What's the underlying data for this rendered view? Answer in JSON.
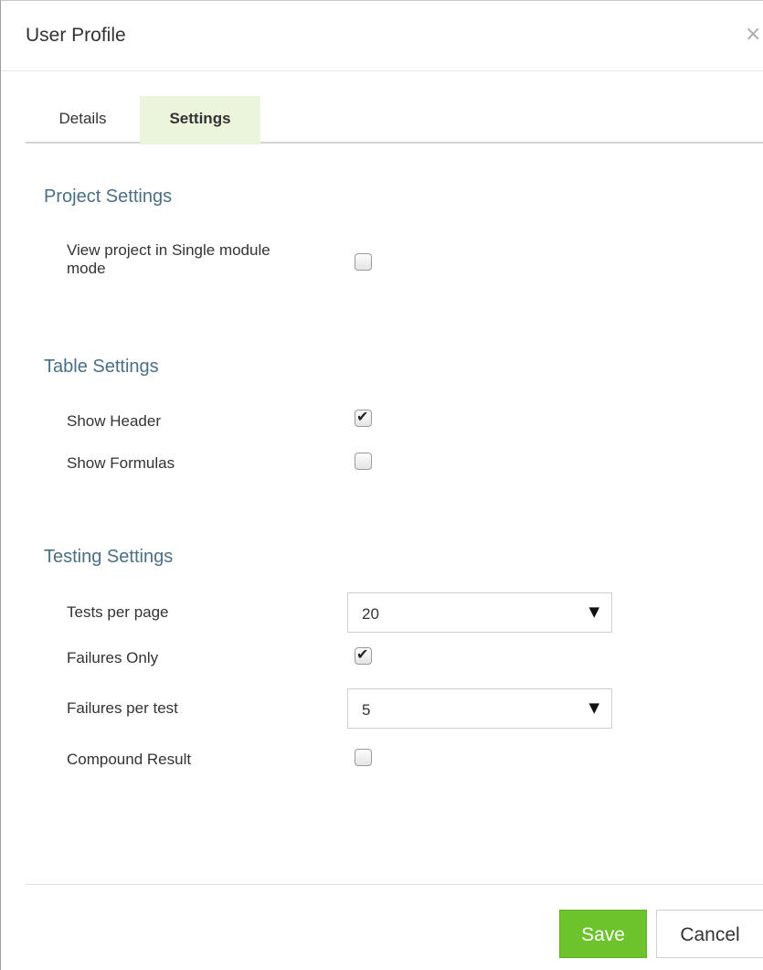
{
  "dialog": {
    "title": "User Profile",
    "close_glyph": "×"
  },
  "tabs": [
    {
      "label": "Details",
      "active": false
    },
    {
      "label": "Settings",
      "active": true
    }
  ],
  "project_settings": {
    "title": "Project Settings",
    "single_module_label_line1": "View project in Single module",
    "single_module_label_line2": "mode",
    "single_module_checked": false
  },
  "table_settings": {
    "title": "Table Settings",
    "show_header_label": "Show Header",
    "show_header_checked": true,
    "show_formulas_label": "Show Formulas",
    "show_formulas_checked": false
  },
  "testing_settings": {
    "title": "Testing Settings",
    "tests_per_page_label": "Tests per page",
    "tests_per_page_value": "20",
    "failures_only_label": "Failures Only",
    "failures_only_checked": true,
    "failures_per_test_label": "Failures per test",
    "failures_per_test_value": "5",
    "compound_result_label": "Compound Result",
    "compound_result_checked": false
  },
  "icons": {
    "checkmark": "✔",
    "dropdown_arrow": "▼"
  },
  "footer": {
    "save_label": "Save",
    "cancel_label": "Cancel"
  },
  "colors": {
    "save_button": "#6cc32c",
    "active_tab": "#eaf5dc",
    "section_title": "#4a6f85"
  }
}
